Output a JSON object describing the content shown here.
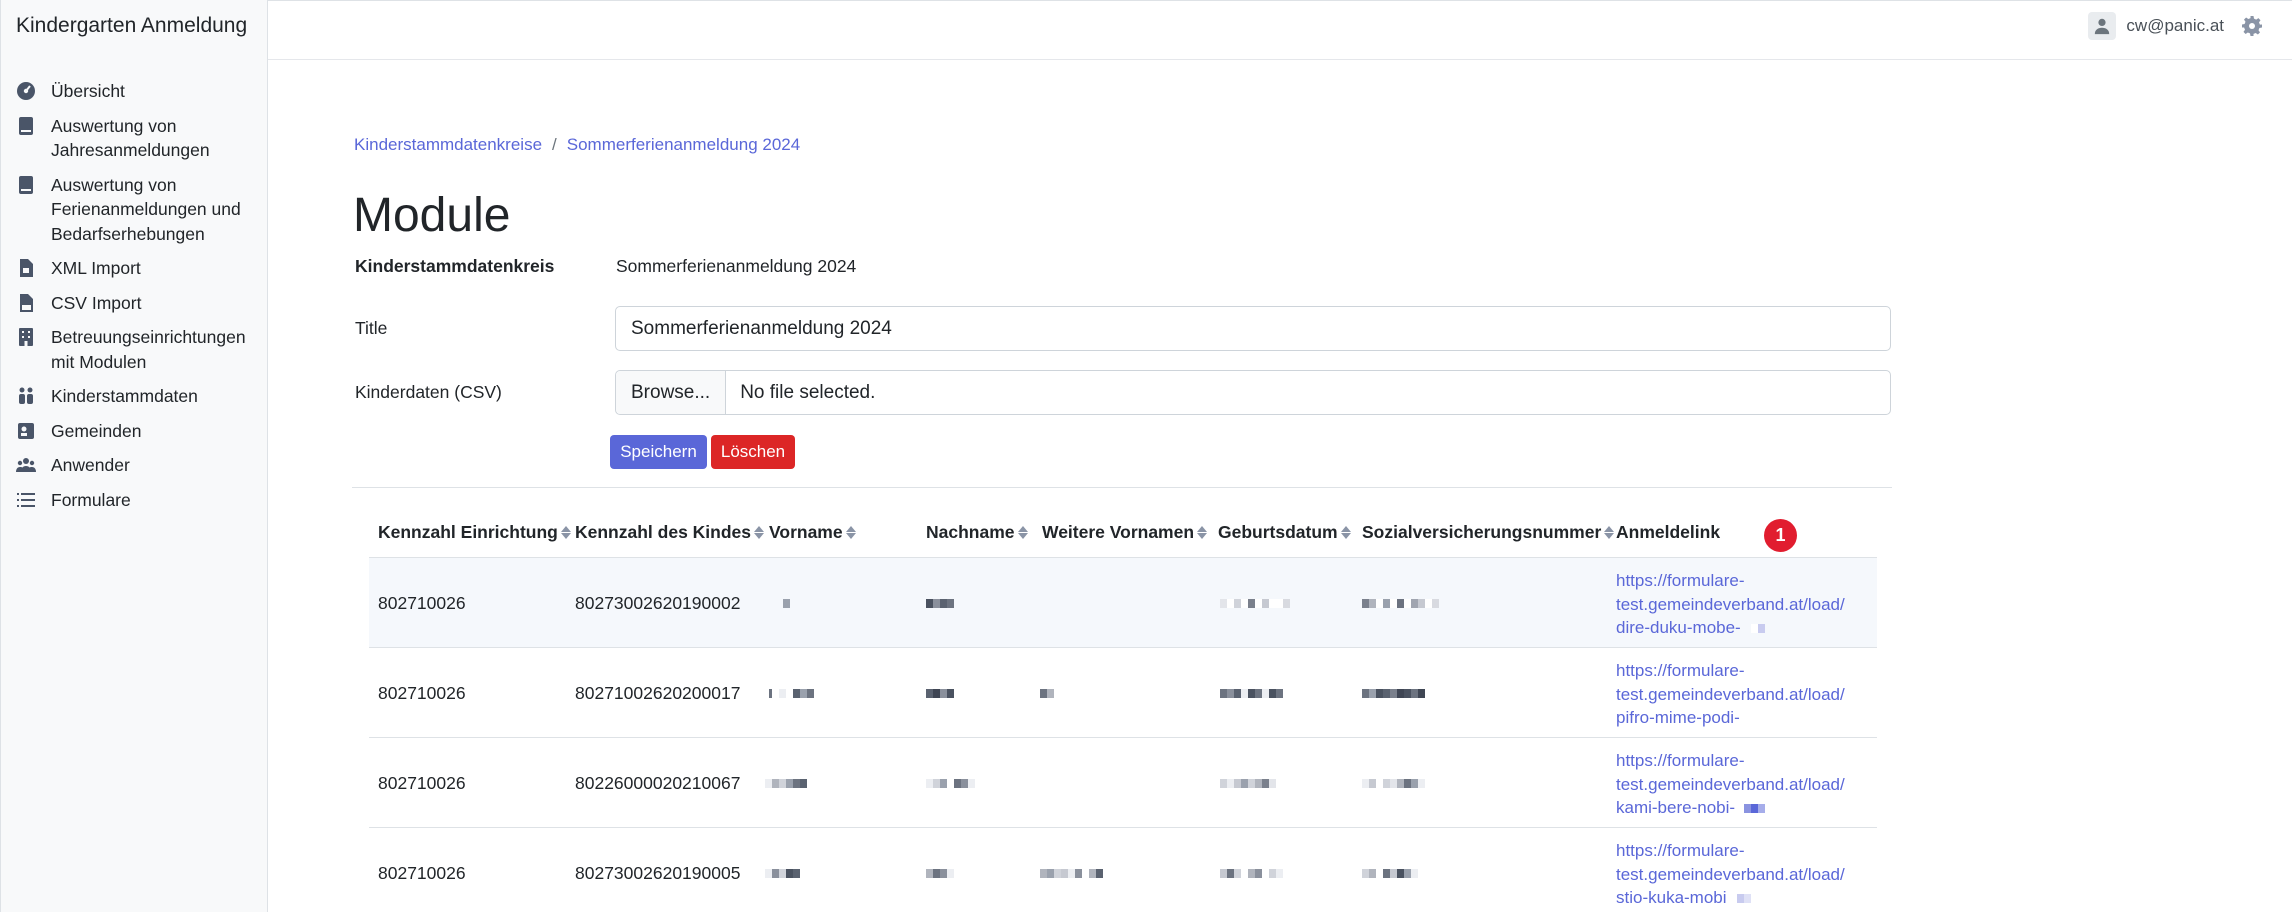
{
  "app": {
    "brand": "Kindergarten Anmeldung"
  },
  "sidebar": {
    "items": [
      {
        "label": "Übersicht",
        "icon": "dashboard-icon"
      },
      {
        "label": "Auswertung von Jahresanmeldungen",
        "icon": "book-icon"
      },
      {
        "label": "Auswertung von Ferienanmeldungen und Bedarfserhebungen",
        "icon": "book-icon"
      },
      {
        "label": "XML Import",
        "icon": "file-code-icon"
      },
      {
        "label": "CSV Import",
        "icon": "file-csv-icon"
      },
      {
        "label": "Betreuungseinrichtungen mit Modulen",
        "icon": "building-icon"
      },
      {
        "label": "Kinderstammdaten",
        "icon": "children-icon"
      },
      {
        "label": "Gemeinden",
        "icon": "address-card-icon"
      },
      {
        "label": "Anwender",
        "icon": "users-icon"
      },
      {
        "label": "Formulare",
        "icon": "list-icon"
      }
    ]
  },
  "header": {
    "user_email": "cw@panic.at",
    "user_icon": "user-icon",
    "settings_icon": "gear-icon"
  },
  "breadcrumb": {
    "parent": "Kinderstammdatenkreise",
    "separator": "/",
    "current": "Sommerferienanmeldung 2024"
  },
  "page": {
    "title": "Module"
  },
  "form": {
    "circle_label": "Kinderstammdatenkreis",
    "circle_value": "Sommerferienanmeldung 2024",
    "title_label": "Title",
    "title_value": "Sommerferienanmeldung 2024",
    "csv_label": "Kinderdaten (CSV)",
    "browse_label": "Browse...",
    "file_status": "No file selected.",
    "save_label": "Speichern",
    "delete_label": "Löschen"
  },
  "colors": {
    "primary": "#5a67d8",
    "danger": "#dc2626",
    "badge": "#e11d2f"
  },
  "table": {
    "badge": "1",
    "columns": [
      "Kennzahl Einrichtung",
      "Kennzahl des Kindes",
      "Vorname",
      "Nachname",
      "Weitere Vornamen",
      "Geburtsdatum",
      "Sozialversicherungsnummer",
      "Anmeldelink"
    ],
    "rows": [
      {
        "einrichtung": "802710026",
        "kind": "80273002620190002",
        "link": [
          "https://formulare-",
          "test.gemeindeverband.at/load/",
          "dire-duku-mobe-"
        ]
      },
      {
        "einrichtung": "802710026",
        "kind": "80271002620200017",
        "link": [
          "https://formulare-",
          "test.gemeindeverband.at/load/",
          "pifro-mime-podi-"
        ]
      },
      {
        "einrichtung": "802710026",
        "kind": "80226000020210067",
        "link": [
          "https://formulare-",
          "test.gemeindeverband.at/load/",
          "kami-bere-nobi-"
        ]
      },
      {
        "einrichtung": "802710026",
        "kind": "80273002620190005",
        "link": [
          "https://formulare-",
          "test.gemeindeverband.at/load/",
          "stio-kuka-mobi"
        ]
      }
    ]
  }
}
